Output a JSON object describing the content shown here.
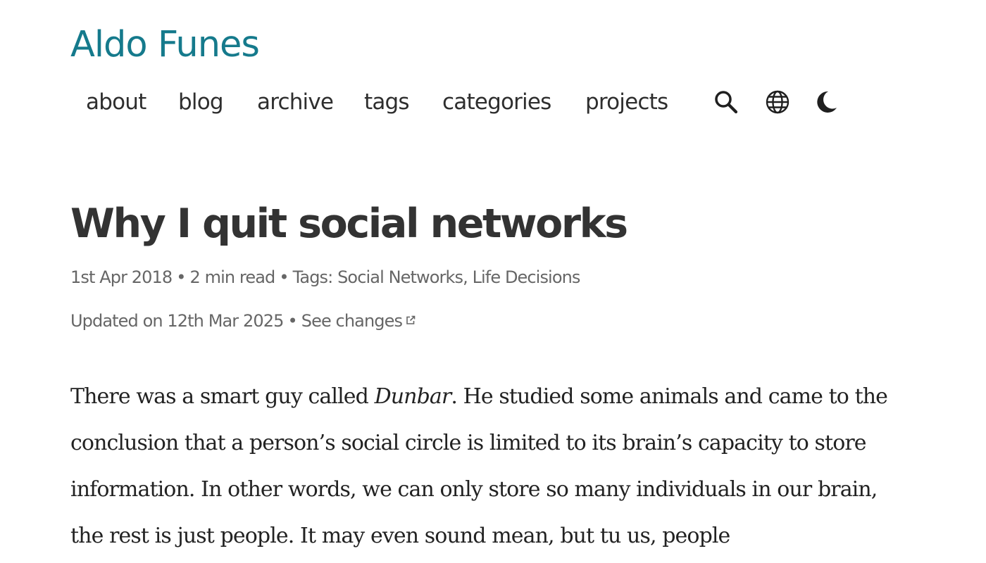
{
  "header": {
    "site_title": "Aldo Funes",
    "nav": [
      {
        "label": "about"
      },
      {
        "label": "blog"
      },
      {
        "label": "archive"
      },
      {
        "label": "tags"
      },
      {
        "label": "categories"
      },
      {
        "label": "projects"
      }
    ],
    "icons": [
      "search-icon",
      "globe-icon",
      "moon-icon"
    ]
  },
  "post": {
    "title": "Why I quit social networks",
    "date": "1st Apr 2018",
    "read_time": "2 min read",
    "tags_label": "Tags:",
    "tags": [
      "Social Networks",
      "Life Decisions"
    ],
    "tag_separator": ",",
    "updated": "Updated on 12th Mar 2025",
    "see_changes": "See changes",
    "separator": "•",
    "body": {
      "part1": "There was a smart guy called ",
      "emphasis": "Dunbar",
      "part2": ". He studied some animals and came to the conclusion that a person’s social circle is limited to its brain’s capacity to store information. In other words, we can only store so many individuals in our brain, the rest is just people. It may even sound mean, but tu us, people"
    }
  },
  "colors": {
    "accent": "#157a8c",
    "text": "#2e2e2e",
    "muted": "#666666"
  }
}
